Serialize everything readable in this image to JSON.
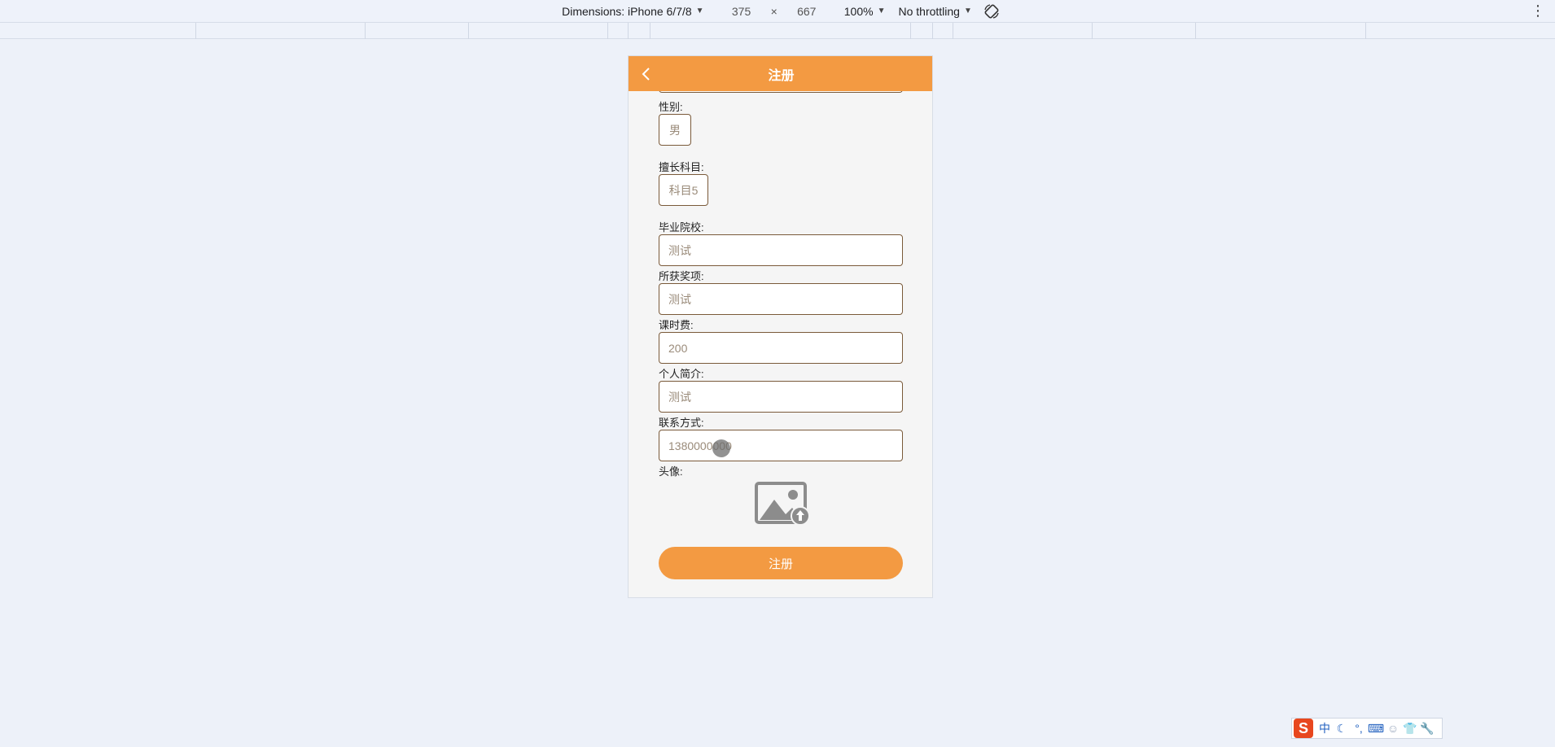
{
  "devtools": {
    "dimensions_label": "Dimensions: iPhone 6/7/8",
    "width": "375",
    "times": "×",
    "height": "667",
    "zoom": "100%",
    "throttling": "No throttling",
    "more": "⋮"
  },
  "header": {
    "title": "注册"
  },
  "form": {
    "gender": {
      "label": "性别:",
      "value": "男"
    },
    "subject": {
      "label": "擅长科目:",
      "value": "科目5"
    },
    "school": {
      "label": "毕业院校:",
      "value": "测试"
    },
    "awards": {
      "label": "所获奖项:",
      "value": "测试"
    },
    "fee": {
      "label": "课时费:",
      "value": "200"
    },
    "intro": {
      "label": "个人简介:",
      "value": "测试"
    },
    "contact": {
      "label": "联系方式:",
      "value": "1380000000"
    },
    "avatar": {
      "label": "头像:"
    },
    "submit_label": "注册"
  },
  "ime": {
    "logo": "S",
    "mode": "中",
    "punct": "°,"
  },
  "colors": {
    "accent": "#f39a42",
    "border": "#7a5a3a",
    "page_bg": "#edf1f9",
    "phone_bg": "#f5f5f5"
  }
}
